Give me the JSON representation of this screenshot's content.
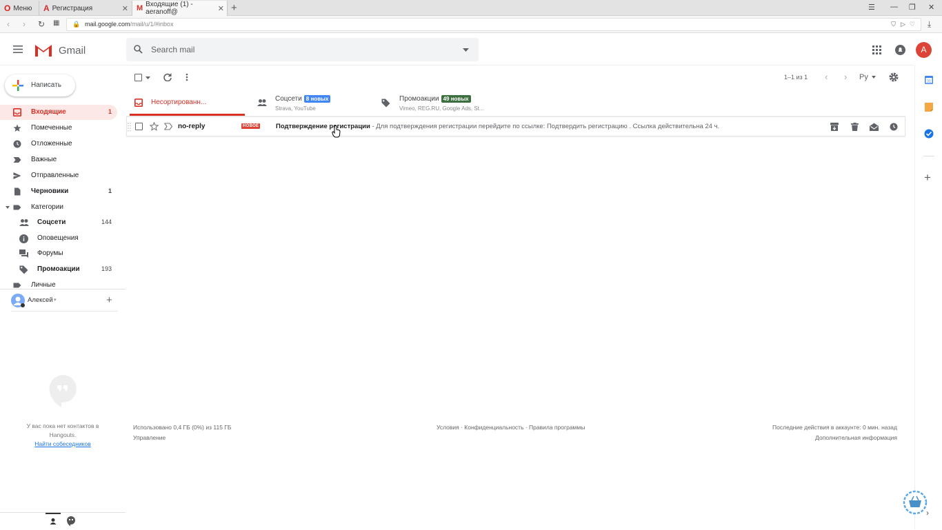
{
  "browser": {
    "tabs": [
      {
        "label": "Меню"
      },
      {
        "label": "Регистрация"
      },
      {
        "label": "Входящие (1) - aeranoff@"
      }
    ],
    "url_host": "mail.google.com",
    "url_path": "/mail/u/1/#inbox"
  },
  "header": {
    "app_name": "Gmail",
    "search_placeholder": "Search mail",
    "avatar_letter": "А"
  },
  "sidebar": {
    "compose_label": "Написать",
    "items": [
      {
        "label": "Входящие",
        "count": "1",
        "icon": "inbox-icon"
      },
      {
        "label": "Помеченные",
        "count": "",
        "icon": "star-icon"
      },
      {
        "label": "Отложенные",
        "count": "",
        "icon": "clock-icon"
      },
      {
        "label": "Важные",
        "count": "",
        "icon": "important-icon"
      },
      {
        "label": "Отправленные",
        "count": "",
        "icon": "send-icon"
      },
      {
        "label": "Черновики",
        "count": "1",
        "icon": "draft-icon"
      },
      {
        "label": "Категории",
        "count": "",
        "icon": "label-icon"
      },
      {
        "label": "Соцсети",
        "count": "144",
        "icon": "people-icon"
      },
      {
        "label": "Оповещения",
        "count": "",
        "icon": "info-icon"
      },
      {
        "label": "Форумы",
        "count": "",
        "icon": "forum-icon"
      },
      {
        "label": "Промоакции",
        "count": "193",
        "icon": "tag-icon"
      },
      {
        "label": "Личные",
        "count": "",
        "icon": "label-icon"
      }
    ],
    "user_name": "Алексей",
    "hangouts_text": "У вас пока нет контактов в Hangouts.",
    "hangouts_link": "Найти собеседников"
  },
  "toolbar": {
    "pagination": "1–1 из 1",
    "lang": "Ру"
  },
  "category_tabs": [
    {
      "label": "Несортированн...",
      "badge": "",
      "sub": ""
    },
    {
      "label": "Соцсети",
      "badge": "8 новых",
      "sub": "Strava, YouTube",
      "badge_color": "#4285f4"
    },
    {
      "label": "Промоакции",
      "badge": "49 новых",
      "sub": "Vimeo, REG.RU, Google Ads, St...",
      "badge_color": "#3c6e40"
    }
  ],
  "email": {
    "sender": "no-reply",
    "tag": "НОВОЕ",
    "subject": "Подтверждение регистрации",
    "snippet": " - Для подтверждения регистрации перейдите по ссылке: Подтвердить регистрацию . Ссылка действительна 24 ч."
  },
  "footer": {
    "storage": "Использовано 0,4 ГБ (0%) из 115 ГБ",
    "manage": "Управление",
    "links": "Условия · Конфиденциальность · Правила программы",
    "activity": "Последние действия в аккаунте: 0 мин. назад",
    "details": "Дополнительная информация"
  }
}
